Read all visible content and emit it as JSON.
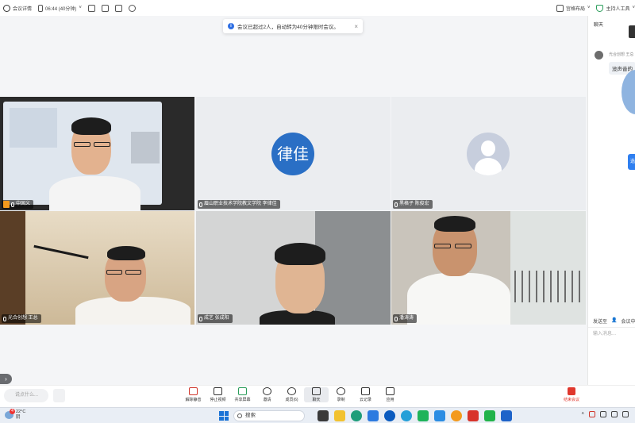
{
  "topbar": {
    "meeting_details": "会议详情",
    "timer": "06:44 (40分钟)",
    "layout_label": "宫格布局",
    "host_tools": "主持人工具"
  },
  "notice": {
    "text": "会议已超过2人，自动转为40分钟限时会议。"
  },
  "participants": [
    {
      "name": "中国义",
      "role": "host",
      "muted": true
    },
    {
      "name": "眉山职业技术学院教文学院 李律佳",
      "avatar_text": "律佳",
      "muted": true
    },
    {
      "name": "黑格子 陈俊宏",
      "muted": true
    },
    {
      "name": "光合创想 王总",
      "muted": false
    },
    {
      "name": "成艺 张成阳",
      "muted": true
    },
    {
      "name": "潘涛涛",
      "muted": false
    }
  ],
  "chat": {
    "title": "聊天",
    "sender": "光合创想 王总",
    "message": "没声音的",
    "blue_button": "选",
    "send_to_label": "发送至",
    "send_to_value": "会议中",
    "input_placeholder": "输入消息..."
  },
  "toolbar": {
    "say_placeholder": "说点什么...",
    "tools": [
      {
        "label": "解除静音",
        "icon": "mic-muted-icon"
      },
      {
        "label": "停止视频",
        "icon": "camera-icon"
      },
      {
        "label": "共享屏幕",
        "icon": "share-screen-icon"
      },
      {
        "label": "邀请",
        "icon": "invite-icon"
      },
      {
        "label": "成员(6)",
        "icon": "members-icon"
      },
      {
        "label": "聊天",
        "icon": "chat-icon",
        "active": true
      },
      {
        "label": "录制",
        "icon": "record-icon"
      },
      {
        "label": "云记录",
        "icon": "cloud-record-icon"
      },
      {
        "label": "应用",
        "icon": "apps-icon"
      }
    ],
    "end_label": "结束会议"
  },
  "taskbar": {
    "weather_badge": "4",
    "temperature": "22°C",
    "weather_text": "阴",
    "search_label": "搜索"
  },
  "colors": {
    "accent": "#2f6fe4",
    "end_red": "#e0382e",
    "avatar_blue": "#2a6fc5"
  }
}
